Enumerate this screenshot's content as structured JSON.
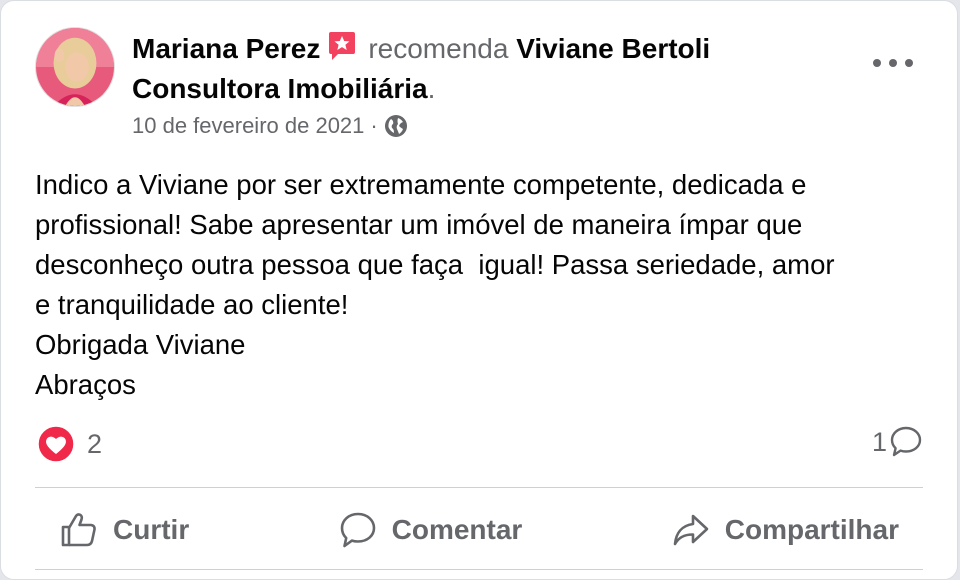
{
  "post": {
    "author": "Mariana Perez",
    "verb": "recomenda",
    "page_name": "Viviane Bertoli Consultora Imobiliária",
    "period": ".",
    "date": "10 de fevereiro de 2021",
    "dot": "·",
    "body_lines": [
      "Indico a Viviane por ser extremamente competente, dedicada e",
      "profissional! Sabe apresentar um imóvel de maneira ímpar que",
      "desconheço outra pessoa que faça  igual! Passa seriedade, amor",
      "e tranquilidade ao cliente!",
      "Obrigada Viviane",
      "Abraços"
    ]
  },
  "stats": {
    "reactions_count": "2",
    "comments_count": "1"
  },
  "actions": {
    "like_label": "Curtir",
    "comment_label": "Comentar",
    "share_label": "Compartilhar"
  },
  "colors": {
    "accent_red": "#f02849",
    "star_badge": "#f3425f",
    "secondary_text": "#65676b"
  },
  "icons": {
    "recommend": "star-badge-icon",
    "privacy": "globe-icon",
    "reaction": "heart-icon",
    "comments": "speech-bubble-icon",
    "more": "more-options-icon",
    "like": "thumbs-up-icon",
    "comment": "comment-icon",
    "share": "share-arrow-icon"
  }
}
